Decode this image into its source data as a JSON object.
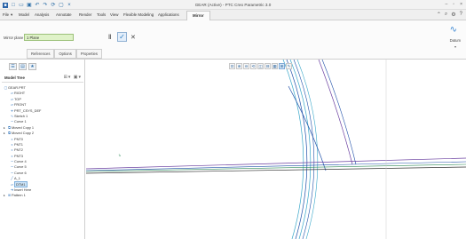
{
  "window": {
    "title": "GEAR (Active) - PTC Creo Parametric 3.0"
  },
  "menu": {
    "tabs": [
      "File",
      "Model",
      "Analysis",
      "Annotate",
      "Render",
      "Tools",
      "View",
      "Flexible Modeling",
      "Applications",
      "Mirror"
    ],
    "active_tab": "Mirror"
  },
  "ribbon": {
    "mirror_plane_label": "Mirror plane",
    "mirror_plane_value": "1 Plane",
    "subtabs": [
      "References",
      "Options",
      "Properties"
    ],
    "datum_label": "Datum"
  },
  "tree": {
    "title": "Model Tree",
    "items": [
      {
        "icon": "part-icon",
        "label": "GEAR.PRT"
      },
      {
        "icon": "plane-icon",
        "label": "RIGHT"
      },
      {
        "icon": "plane-icon",
        "label": "TOP"
      },
      {
        "icon": "plane-icon",
        "label": "FRONT"
      },
      {
        "icon": "csys-icon",
        "label": "PRT_CSYS_DEF"
      },
      {
        "icon": "sketch-icon",
        "label": "Sketch 1"
      },
      {
        "icon": "curve-icon",
        "label": "Curve 1"
      },
      {
        "icon": "moved-copy-icon",
        "label": "Moved Copy 1",
        "expander": true
      },
      {
        "icon": "moved-copy-icon",
        "label": "Moved Copy 2",
        "expander": true
      },
      {
        "icon": "point-icon",
        "label": "PNT0"
      },
      {
        "icon": "point-icon",
        "label": "PNT1"
      },
      {
        "icon": "point-icon",
        "label": "PNT2"
      },
      {
        "icon": "point-icon",
        "label": "PNT3"
      },
      {
        "icon": "curve-icon",
        "label": "Curve 4"
      },
      {
        "icon": "curve-icon",
        "label": "Curve 5"
      },
      {
        "icon": "curve-icon",
        "label": "Curve 6"
      },
      {
        "icon": "axis-icon",
        "label": "A_1"
      },
      {
        "icon": "plane-icon",
        "label": "DTM1",
        "selected": true
      },
      {
        "icon": "insert-here-icon",
        "label": "Insert Here"
      },
      {
        "icon": "pattern-icon",
        "label": "Pattern 1",
        "expander": true
      }
    ]
  },
  "colors": {
    "accent": "#2f7fc4",
    "mirror_plane_field": "#dff2c8",
    "curve_blue": "#1f4fa8",
    "curve_cyan": "#38a7c9",
    "curve_purple": "#6a3fa0",
    "axis_green": "#2e8b57"
  }
}
